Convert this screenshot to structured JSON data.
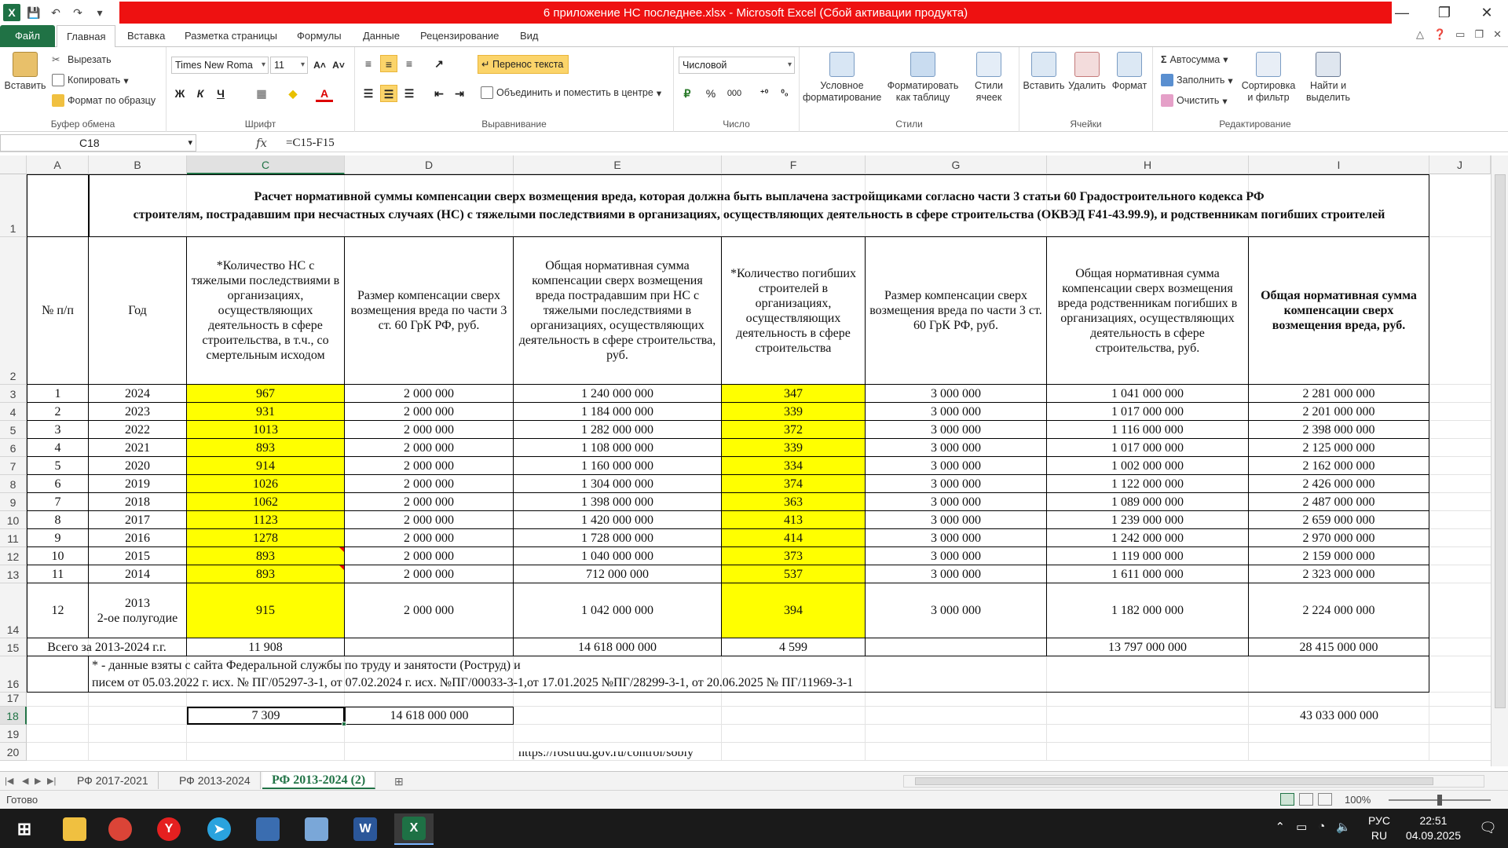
{
  "window": {
    "title": "6 приложение НС последнее.xlsx - Microsoft Excel (Сбой активации продукта)",
    "app_letter": "X"
  },
  "ribbon_tabs": [
    "Файл",
    "Главная",
    "Вставка",
    "Разметка страницы",
    "Формулы",
    "Данные",
    "Рецензирование",
    "Вид"
  ],
  "ribbon": {
    "clipboard": {
      "paste": "Вставить",
      "cut": "Вырезать",
      "copy": "Копировать",
      "format_painter": "Формат по образцу",
      "label": "Буфер обмена"
    },
    "font": {
      "name": "Times New Roma",
      "size": "11",
      "bold": "Ж",
      "italic": "К",
      "underline": "Ч",
      "label": "Шрифт"
    },
    "alignment": {
      "wrap": "Перенос текста",
      "merge": "Объединить и поместить в центре",
      "label": "Выравнивание"
    },
    "number": {
      "format": "Числовой",
      "percent": "%",
      "thousands": "000",
      "label": "Число"
    },
    "styles": {
      "conditional": "Условное форматирование",
      "as_table": "Форматировать как таблицу",
      "cell_styles": "Стили ячеек",
      "label": "Стили"
    },
    "cells": {
      "insert": "Вставить",
      "delete": "Удалить",
      "format": "Формат",
      "label": "Ячейки"
    },
    "editing": {
      "autosum": "Автосумма",
      "fill": "Заполнить",
      "clear": "Очистить",
      "sort": "Сортировка и фильтр",
      "find": "Найти и выделить",
      "label": "Редактирование"
    }
  },
  "formula_bar": {
    "name_box": "C18",
    "fx": "fx",
    "formula": "=C15-F15"
  },
  "columns": [
    "A",
    "B",
    "C",
    "D",
    "E",
    "F",
    "G",
    "H",
    "I",
    "J"
  ],
  "selected_column": "C",
  "selected_row": "18",
  "title_block": {
    "line1": "Расчет нормативной суммы компенсации сверх возмещения вреда, которая должна быть выплачена застройщиками согласно части 3 статьи 60 Градостроительного кодекса РФ",
    "line2": "строителям, пострадавшим при несчастных случаях (НС) с тяжелыми последствиями в организациях, осуществляющих деятельность в сфере строительства (ОКВЭД F41-43.99.9), и родственникам погибших строителей"
  },
  "headers": {
    "a": "№ п/п",
    "b": "Год",
    "c": "*Количество НС с тяжелыми последствиями в организациях, осуществляющих деятельность в сфере строительства, в т.ч., со смертельным исходом",
    "d": "Размер компенсации сверх возмещения вреда по части 3 ст. 60 ГрК РФ, руб.",
    "e": "Общая нормативная сумма компенсации сверх возмещения вреда пострадавшим при НС с тяжелыми последствиями в организациях, осуществляющих деятельность в сфере строительства, руб.",
    "f": "*Количество погибших строителей в организациях, осуществляющих деятельность в сфере строительства",
    "g": "Размер компенсации сверх возмещения вреда по части 3 ст. 60 ГрК РФ, руб.",
    "h": "Общая нормативная сумма компенсации сверх возмещения вреда родственникам погибших в организациях, осуществляющих деятельность в сфере строительства, руб.",
    "i": "Общая нормативная сумма компенсации сверх возмещения вреда, руб."
  },
  "rows": [
    {
      "n": "1",
      "year": "2024",
      "c": "967",
      "d": "2 000 000",
      "e": "1 240 000 000",
      "f": "347",
      "g": "3 000 000",
      "h": "1 041 000 000",
      "i": "2 281 000 000"
    },
    {
      "n": "2",
      "year": "2023",
      "c": "931",
      "d": "2 000 000",
      "e": "1 184 000 000",
      "f": "339",
      "g": "3 000 000",
      "h": "1 017 000 000",
      "i": "2 201 000 000"
    },
    {
      "n": "3",
      "year": "2022",
      "c": "1013",
      "d": "2 000 000",
      "e": "1 282 000 000",
      "f": "372",
      "g": "3 000 000",
      "h": "1 116 000 000",
      "i": "2 398 000 000"
    },
    {
      "n": "4",
      "year": "2021",
      "c": "893",
      "d": "2 000 000",
      "e": "1 108 000 000",
      "f": "339",
      "g": "3 000 000",
      "h": "1 017 000 000",
      "i": "2 125 000 000"
    },
    {
      "n": "5",
      "year": "2020",
      "c": "914",
      "d": "2 000 000",
      "e": "1 160 000 000",
      "f": "334",
      "g": "3 000 000",
      "h": "1 002 000 000",
      "i": "2 162 000 000"
    },
    {
      "n": "6",
      "year": "2019",
      "c": "1026",
      "d": "2 000 000",
      "e": "1 304 000 000",
      "f": "374",
      "g": "3 000 000",
      "h": "1 122 000 000",
      "i": "2 426 000 000"
    },
    {
      "n": "7",
      "year": "2018",
      "c": "1062",
      "d": "2 000 000",
      "e": "1 398 000 000",
      "f": "363",
      "g": "3 000 000",
      "h": "1 089 000 000",
      "i": "2 487 000 000"
    },
    {
      "n": "8",
      "year": "2017",
      "c": "1123",
      "d": "2 000 000",
      "e": "1 420 000 000",
      "f": "413",
      "g": "3 000 000",
      "h": "1 239 000 000",
      "i": "2 659 000 000"
    },
    {
      "n": "9",
      "year": "2016",
      "c": "1278",
      "d": "2 000 000",
      "e": "1 728 000 000",
      "f": "414",
      "g": "3 000 000",
      "h": "1 242 000 000",
      "i": "2 970 000 000"
    },
    {
      "n": "10",
      "year": "2015",
      "c": "893",
      "d": "2 000 000",
      "e": "1 040 000 000",
      "f": "373",
      "g": "3 000 000",
      "h": "1 119 000 000",
      "i": "2 159 000 000"
    },
    {
      "n": "11",
      "year": "2014",
      "c": "893",
      "d": "2 000 000",
      "e": "712 000 000",
      "f": "537",
      "g": "3 000 000",
      "h": "1 611 000 000",
      "i": "2 323 000 000"
    },
    {
      "n": "12",
      "year": "2013\n2-ое полугодие",
      "c": "915",
      "d": "2 000 000",
      "e": "1 042 000 000",
      "f": "394",
      "g": "3 000 000",
      "h": "1 182 000 000",
      "i": "2 224 000 000"
    }
  ],
  "total_row": {
    "label": "Всего за 2013-2024 г.г.",
    "c": "11 908",
    "e": "14 618 000 000",
    "f": "4 599",
    "h": "13 797 000 000",
    "i": "28 415 000 000"
  },
  "note": {
    "line1": "* -  данные взяты с сайта Федеральной службы по труду и занятости (Роструд) и",
    "line2": "писем от 05.03.2022 г. исх. № ПГ/05297-3-1, от 07.02.2024 г. исх. №ПГ/00033-3-1,от 17.01.2025 №ПГ/28299-3-1, от 20.06.2025 № ПГ/11969-3-1"
  },
  "row18": {
    "c": "7 309",
    "d": "14 618 000 000",
    "i": "43 033 000 000"
  },
  "row20_partial": "https://rostrud.gov.ru/control/sobly",
  "sheets": [
    "РФ 2017-2021",
    "РФ 2013-2024",
    "РФ 2013-2024 (2)"
  ],
  "status": {
    "ready": "Готово",
    "zoom": "100%"
  },
  "taskbar": {
    "lang_top": "РУС",
    "lang_bottom": "RU",
    "time": "22:51",
    "date": "04.09.2025"
  }
}
